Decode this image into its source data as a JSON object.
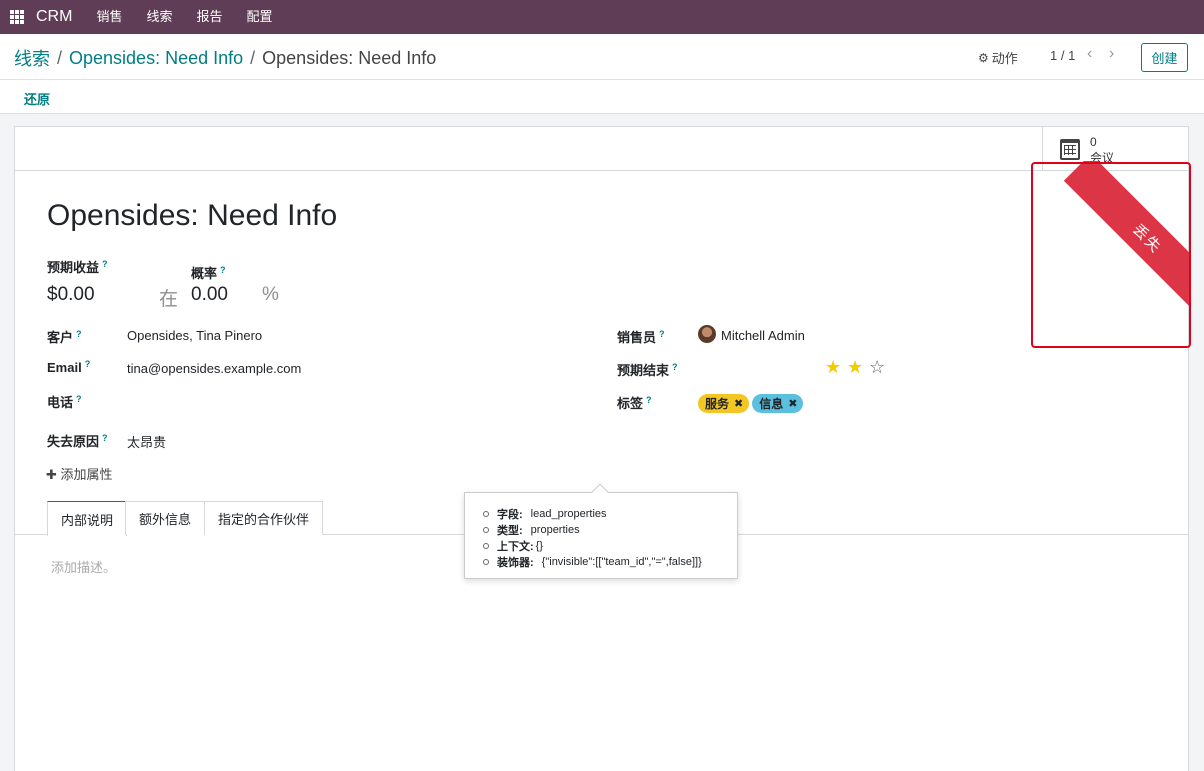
{
  "navbar": {
    "brand": "CRM",
    "menu": [
      "销售",
      "线索",
      "报告",
      "配置"
    ]
  },
  "control": {
    "breadcrumb": [
      "线索",
      "Opensides: Need Info",
      "Opensides: Need Info"
    ],
    "separator": "/",
    "action_label": "动作",
    "pager": "1 / 1",
    "create_label": "创建",
    "restore_label": "还原"
  },
  "stat_button": {
    "value": "0",
    "label": "会议"
  },
  "ribbon": {
    "text": "丢失"
  },
  "record": {
    "title": "Opensides: Need Info",
    "expected_revenue_label": "预期收益",
    "expected_revenue": "$0.00",
    "at_word": "在",
    "probability_label": "概率",
    "probability": "0.00",
    "percent": "%",
    "help_mark": "?"
  },
  "fields_left": [
    {
      "label": "客户",
      "value": "Opensides, Tina Pinero"
    },
    {
      "label": "Email",
      "value": "tina@opensides.example.com"
    },
    {
      "label": "电话",
      "value": ""
    },
    {
      "label": "失去原因",
      "value": "太昂贵"
    }
  ],
  "fields_right": {
    "salesperson_label": "销售员",
    "salesperson": "Mitchell Admin",
    "expected_closing_label": "预期结束",
    "priority_stars": 2,
    "priority_max": 3,
    "tags_label": "标签",
    "tags": [
      {
        "label": "服务",
        "bg": "#f3c623",
        "fg": "#212529"
      },
      {
        "label": "信息",
        "bg": "#5bc0de",
        "fg": "#212529"
      }
    ]
  },
  "add_property_label": "添加属性",
  "tabs": [
    "内部说明",
    "额外信息",
    "指定的合作伙伴"
  ],
  "description_placeholder": "添加描述。",
  "tooltip": [
    {
      "key": "字段:",
      "value": "lead_properties"
    },
    {
      "key": "类型:",
      "value": "properties"
    },
    {
      "key": "上下文:",
      "value": "{}"
    },
    {
      "key": "装饰器:",
      "value": "{\"invisible\":[[\"team_id\",\"=\",false]]}"
    }
  ],
  "colors": {
    "navbar": "#5f3d56",
    "accent": "#017e84",
    "ribbon": "#dc3545",
    "highlight": "#e0001b"
  }
}
